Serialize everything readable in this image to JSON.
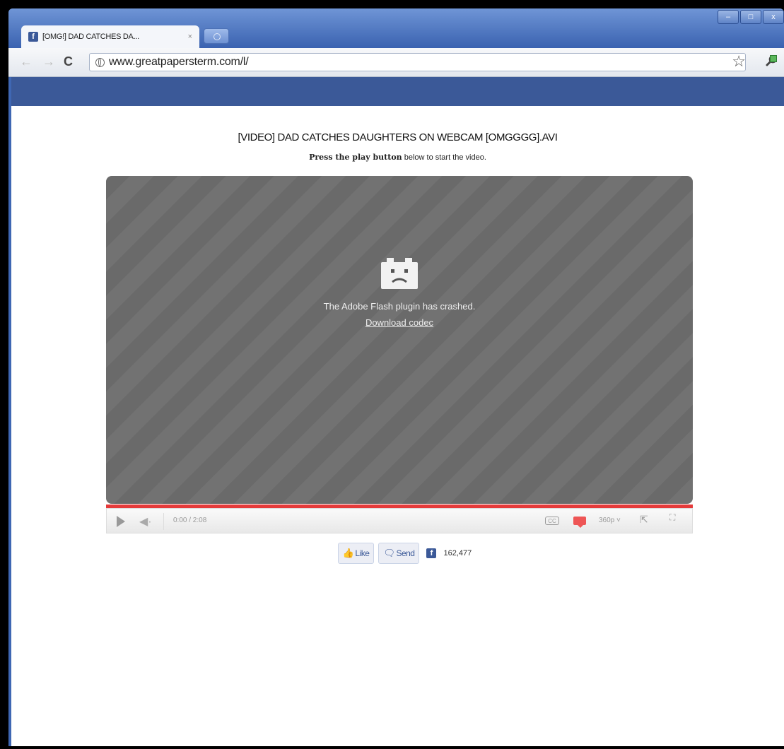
{
  "window": {
    "controls": [
      "–",
      "□",
      "x"
    ]
  },
  "tab": {
    "title": "[OMG!] DAD CATCHES DA...",
    "close": "×",
    "favicon": "f"
  },
  "toolbar": {
    "back": "←",
    "forward": "→",
    "reload": "C",
    "url": "www.greatpapersterm.com/l/",
    "star": "☆",
    "wrench": "🔧"
  },
  "page": {
    "title": "[VIDEO] DAD CATCHES DAUGHTERS ON WEBCAM [OMGGGG].AVI",
    "instruction_bold": "Press the play button",
    "instruction_rest": " below to start the video."
  },
  "player": {
    "crash_message": "The Adobe Flash plugin has crashed.",
    "download_link": "Download codec",
    "time": "0:00 / 2:08",
    "cc": "CC",
    "quality": "360p ˅",
    "volume_icon": "◀·",
    "popout_icon": "⇱",
    "fullscreen_icon": "⛶",
    "progress": 0,
    "colors": {
      "progress": "#e53a3a",
      "annotation": "#ee5555"
    }
  },
  "social": {
    "like": "Like",
    "send": "Send",
    "fb_icon": "f",
    "count": "162,477"
  },
  "colors": {
    "facebook_blue": "#3b5998",
    "window_frame": "#3f67b3"
  }
}
